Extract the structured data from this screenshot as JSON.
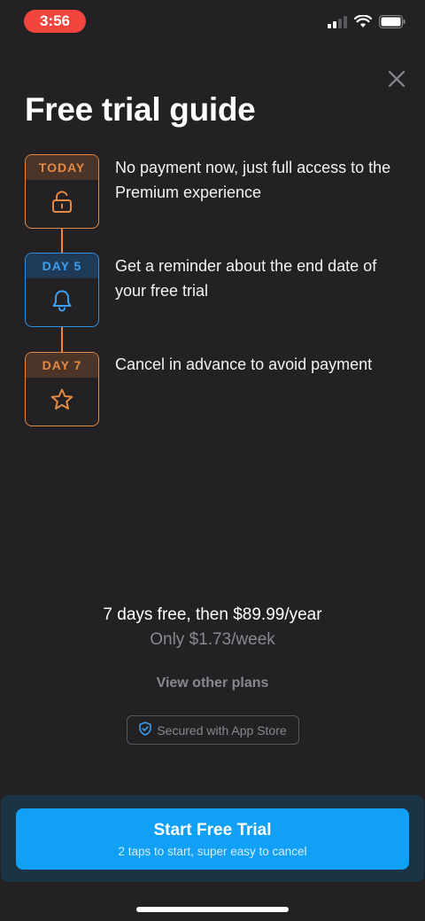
{
  "status_bar": {
    "time": "3:56"
  },
  "title": "Free trial guide",
  "steps": [
    {
      "label": "TODAY",
      "icon": "unlock-icon",
      "text": "No payment now, just full access to the Premium experience",
      "color": "#e58a43"
    },
    {
      "label": "DAY 5",
      "icon": "bell-icon",
      "text": "Get a reminder about the end date of your free trial",
      "color": "#2f8fe0"
    },
    {
      "label": "DAY 7",
      "icon": "star-icon",
      "text": "Cancel in advance to avoid payment",
      "color": "#e58a43"
    }
  ],
  "pricing": {
    "main": "7 days free, then $89.99/year",
    "weekly": "Only $1.73/week"
  },
  "other_plans_label": "View other plans",
  "secured_label": "Secured with App Store",
  "cta": {
    "title": "Start Free Trial",
    "subtitle": "2 taps to start, super easy to cancel",
    "color": "#10a0f5"
  }
}
